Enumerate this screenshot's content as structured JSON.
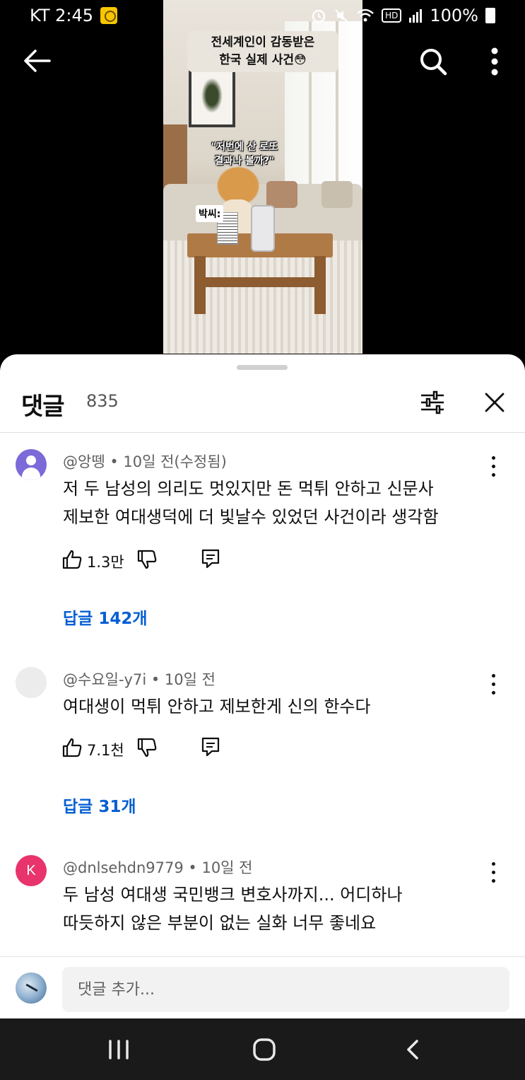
{
  "status_bar": {
    "carrier_time": "KT 2:45",
    "hd_label": "HD",
    "battery": "100%"
  },
  "video": {
    "title_line1": "전세계인이 감동받은",
    "title_line2": "한국 실제 사건😳",
    "quote_line1": "\"저번에 산 로또",
    "quote_line2": "결과나 볼까?\"",
    "name_tag": "박씨:"
  },
  "comments_panel": {
    "title": "댓글",
    "count": "835"
  },
  "comments": [
    {
      "author_meta": "@앙뗑 • 10일 전(수정됨)",
      "line1": "저 두 남성의 의리도 멋있지만 돈 먹튀 안하고 신문사",
      "line2": "제보한 여대생덕에 더 빛날수 있었던 사건이라 생각함",
      "likes": "1.3만",
      "replies": "답글 142개"
    },
    {
      "author_meta": "@수요일-y7i • 10일 전",
      "line1": "여대생이 먹튀 안하고 제보한게 신의 한수다",
      "likes": "7.1천",
      "replies": "답글 31개"
    },
    {
      "author_meta": "@dnlsehdn9779 • 10일 전",
      "avatar_letter": "K",
      "line1": "두 남성 여대생 국민뱅크 변호사까지... 어디하나",
      "line2": "따듯하지 않은 부분이 없는 실화 너무 좋네요"
    }
  ],
  "composer": {
    "placeholder": "댓글 추가..."
  },
  "icons": {
    "back": "arrow-left-icon",
    "search": "search-icon",
    "more": "more-vert-icon",
    "filter": "sliders-icon",
    "close": "close-icon",
    "like": "thumbs-up-icon",
    "dislike": "thumbs-down-icon",
    "reply": "comment-icon"
  },
  "colors": {
    "link": "#065fd4",
    "avatar_purple": "#7b6ad8",
    "avatar_pink": "#e8336d"
  }
}
